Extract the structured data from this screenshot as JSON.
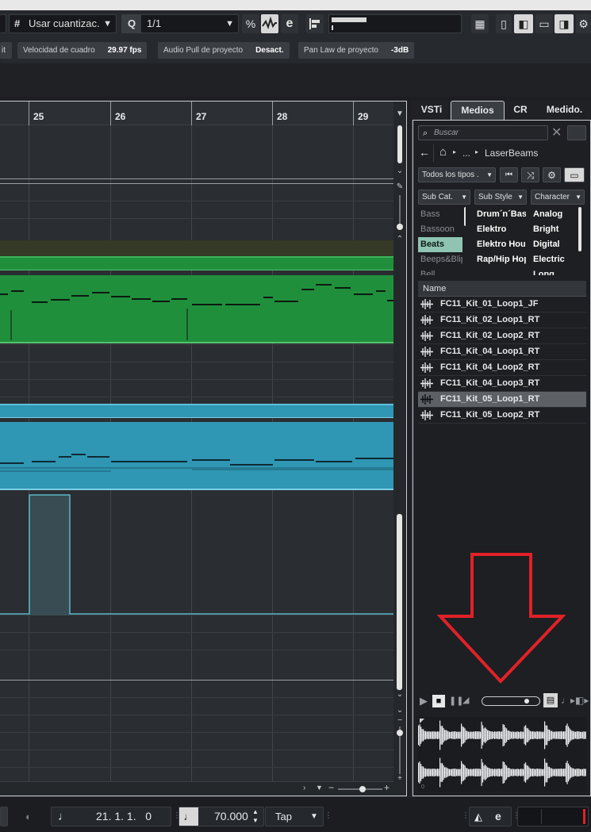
{
  "toolbar": {
    "quantize_label": "Usar cuantizac.",
    "quantize_value": "1/1"
  },
  "statusbar": {
    "partial_label": "it",
    "frame_rate_label": "Velocidad de cuadro",
    "frame_rate_value": "29.97 fps",
    "audio_pull_label": "Audio Pull de proyecto",
    "audio_pull_value": "Desact.",
    "pan_law_label": "Pan Law de proyecto",
    "pan_law_value": "-3dB"
  },
  "ruler": {
    "bars": [
      "25",
      "26",
      "27",
      "28",
      "29"
    ]
  },
  "right_panel": {
    "tabs": [
      "VSTi",
      "Medios",
      "CR",
      "Medido."
    ],
    "active_tab": "Medios",
    "search_placeholder": "Buscar",
    "breadcrumb_ellipsis": "...",
    "breadcrumb_folder": "LaserBeams",
    "type_filter": "Todos los tipos .",
    "columns": [
      "Sub Cat.",
      "Sub Style",
      "Character"
    ],
    "subcategories": [
      "Bass",
      "Bassoon",
      "Beats",
      "Beeps&Blip",
      "Bell"
    ],
    "selected_subcategory": "Beats",
    "substyles": [
      "Drum´n´Bass",
      "Elektro",
      "Elektro House",
      "Rap/Hip Hop"
    ],
    "characters": [
      "Analog",
      "Bright",
      "Digital",
      "Electric",
      "Long"
    ],
    "results_header": "Name",
    "results": [
      "FC11_Kit_01_Loop1_JF",
      "FC11_Kit_02_Loop1_RT",
      "FC11_Kit_02_Loop2_RT",
      "FC11_Kit_04_Loop1_RT",
      "FC11_Kit_04_Loop2_RT",
      "FC11_Kit_04_Loop3_RT",
      "FC11_Kit_05_Loop1_RT",
      "FC11_Kit_05_Loop2_RT"
    ],
    "selected_result": "FC11_Kit_05_Loop1_RT",
    "preview_volume": 0.85
  },
  "transport": {
    "position": "21. 1. 1.   0",
    "tempo": "70.000",
    "tap_label": "Tap"
  },
  "colors": {
    "midi_green": "#1f8f3c",
    "midi_cyan": "#2f96b3",
    "annotation_red": "#e12128",
    "selected_category": "#8fc4b2"
  }
}
